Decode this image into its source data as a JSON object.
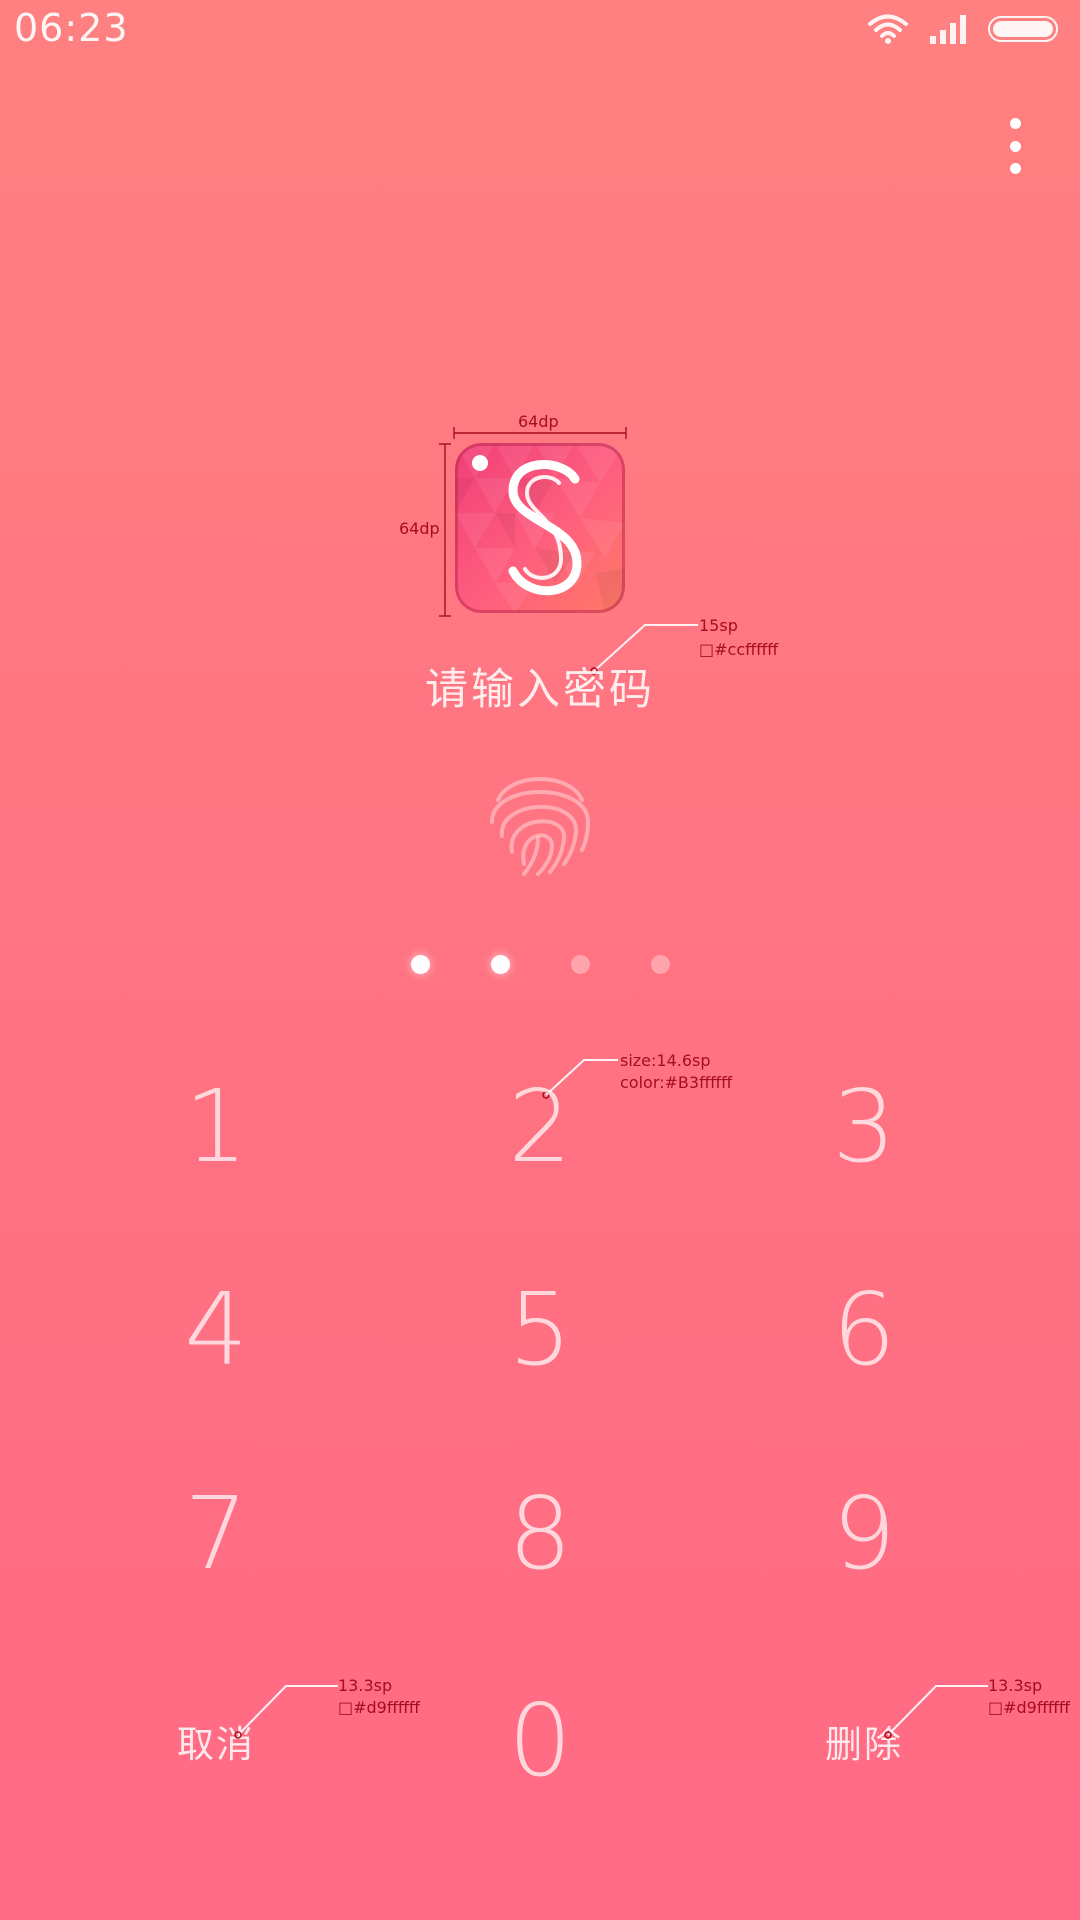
{
  "status_bar": {
    "time": "06:23",
    "icons": [
      "wifi-icon",
      "signal-icon",
      "battery-icon"
    ]
  },
  "menu": {
    "icon": "more-vert-icon"
  },
  "app_icon": {
    "letter": "S",
    "colors": [
      "#f03e78",
      "#ff5f7e",
      "#ff7a66"
    ]
  },
  "annotations": {
    "icon_width": "64dp",
    "icon_height": "64dp",
    "prompt_size": "15sp",
    "prompt_color": "□#ccffffff",
    "key_size": "size:14.6sp",
    "key_color": "color:#B3ffffff",
    "cancel_size": "13.3sp",
    "cancel_color": "□#d9ffffff",
    "delete_size": "13.3sp",
    "delete_color": "□#d9ffffff"
  },
  "prompt": "请输入密码",
  "fingerprint": {
    "icon": "fingerprint-icon"
  },
  "pin": {
    "length": 4,
    "entered": 2
  },
  "keypad": {
    "keys": [
      "1",
      "2",
      "3",
      "4",
      "5",
      "6",
      "7",
      "8",
      "9"
    ],
    "zero": "0",
    "cancel": "取消",
    "delete": "删除"
  },
  "colors": {
    "background_top": "#ff8080",
    "background_bottom": "#ff6a84",
    "annotation": "#a60d1e"
  }
}
